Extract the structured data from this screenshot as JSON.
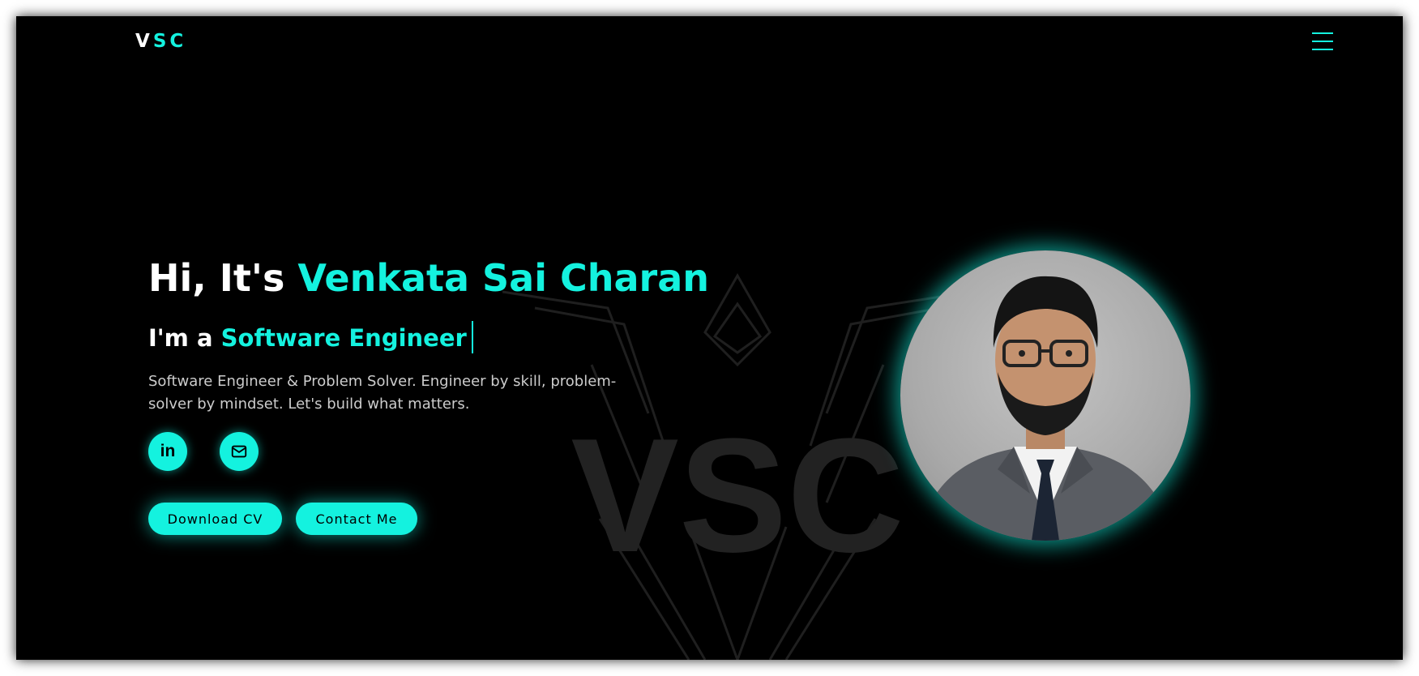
{
  "brand": {
    "logo_white": "V",
    "logo_accent": "SC"
  },
  "hero": {
    "greeting": "Hi, It's ",
    "name": "Venkata Sai Charan",
    "role_prefix": "I'm a ",
    "role": "Software Engineer",
    "description": "Software Engineer & Problem Solver. Engineer by skill, problem-solver by mindset. Let's build what matters."
  },
  "social": [
    {
      "icon": "linkedin-icon",
      "label": "in"
    },
    {
      "icon": "mail-icon"
    }
  ],
  "buttons": {
    "download": "Download CV",
    "contact": "Contact Me"
  },
  "watermark": {
    "text": "VSC"
  },
  "colors": {
    "accent": "#14f2df",
    "background": "#000000",
    "text": "#ffffff",
    "muted": "#cccccc"
  }
}
